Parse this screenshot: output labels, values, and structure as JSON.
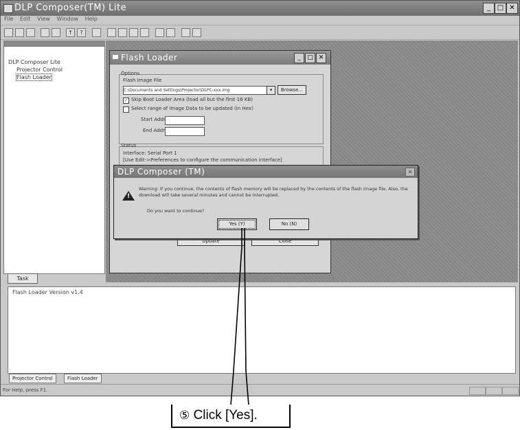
{
  "app": {
    "title": "DLP Composer(TM) Lite",
    "menu": [
      "File",
      "Edit",
      "View",
      "Window",
      "Help"
    ],
    "tree": {
      "root": "DLP Composer Lite",
      "children": [
        "Projector Control",
        "Flash Loader"
      ]
    },
    "left_tab": "Task",
    "output_line": "Flash Loader Version v1.4",
    "output_tabs": [
      "Projector Control",
      "Flash Loader"
    ],
    "status": "For Help, press F1"
  },
  "flash_loader": {
    "title": "Flash Loader",
    "options_label": "Options",
    "image_file_label": "Flash Image File",
    "image_file_value": "C:\\Documents and Settings\\Projector\\DLPC-xxx.img",
    "browse_label": "Browse...",
    "skip_boot_label": "Skip Boot Loader Area (load all but the first 16 KB)",
    "range_label": "Select range of Image Data to be updated (in Hex)",
    "start_label": "Start Addr",
    "end_label": "End Addr",
    "status_label": "Status",
    "status_line1": "Interface: Serial Port 1",
    "status_line2": "[Use Edit->Preferences to configure the communication interface]",
    "btn_update": "Update",
    "btn_close": "Close"
  },
  "dialog": {
    "title": "DLP Composer (TM)",
    "icon": "warning-icon",
    "message": "Warning: If you continue, the contents of flash memory will be replaced by the contents of the flash image file. Also, the download will take several minutes and cannot be interrupted.",
    "question": "Do you want to continue?",
    "yes_label": "Yes (Y)",
    "no_label": "No (N)"
  },
  "callout": {
    "step": "⑤",
    "text": "Click [Yes]."
  }
}
